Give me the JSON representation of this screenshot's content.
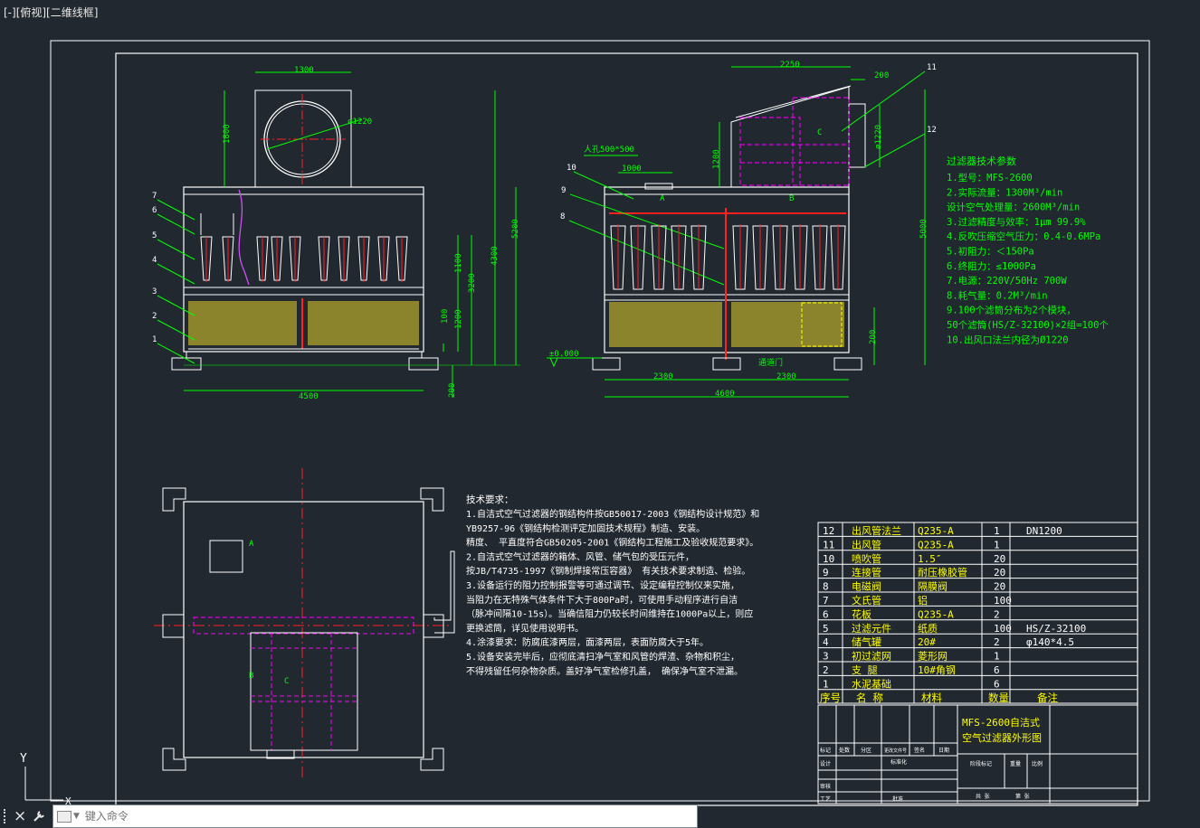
{
  "viewport": {
    "label": "[-][俯视][二维线框]"
  },
  "command_line": {
    "placeholder": "键入命令"
  },
  "ucs": {
    "y_label": "Y",
    "x_label": "X"
  },
  "front_view": {
    "dims": {
      "top_width": "1300",
      "diameter": "ø1220",
      "hood_height": "1800",
      "h5200": "5200",
      "h4300": "4300",
      "h3200": "3200",
      "h1100": "1100",
      "h1200": "1200",
      "h100": "100",
      "h200": "200",
      "width": "4500"
    },
    "balloons": [
      "7",
      "6",
      "5",
      "4",
      "3",
      "2",
      "1"
    ]
  },
  "side_view": {
    "dims": {
      "top_2250": "2250",
      "d200": "200",
      "d1000": "1000",
      "manhole": "人孔500*500",
      "h1200": "1200",
      "h5000": "5000",
      "dia": "ø1220",
      "h200": "200",
      "left2300": "2300",
      "right2300": "2300",
      "total": "4600",
      "elev": "±0.000"
    },
    "letters": {
      "a": "A",
      "b": "B",
      "c": "C"
    },
    "balloons": [
      "10",
      "9",
      "8",
      "11",
      "12"
    ],
    "access_door": "通道门"
  },
  "plan_view": {
    "letters": {
      "a": "A",
      "b": "B",
      "c": "C"
    }
  },
  "tech_params": {
    "title": "过滤器技术参数",
    "lines": [
      "1.型号：MFS-2600",
      "2.实际流量：1300M³/min",
      "  设计空气处理量：2600M³/min",
      "3.过滤精度与效率：1μm  99.9%",
      "4.反吹压缩空气压力：0.4-0.6MPa",
      "5.初阻力：＜150Pa",
      "6.终阻力：≤1000Pa",
      "7.电源：220V/50Hz 700W",
      "8.耗气量：0.2M³/min",
      "9.100个滤筒分布为2个模块，",
      "  50个滤筒(HS/Z-32100)×2组=100个",
      "10.出风口法兰内径为Ø1220"
    ]
  },
  "tech_requirements": {
    "title": "技术要求：",
    "lines": [
      "1.自洁式空气过滤器的钢结构件按GB50017-2003《钢结构设计规范》和",
      "YB9257-96《钢结构检测评定加固技术规程》制造、安装。",
      "精度、 平直度符合GB50205-2001《钢结构工程施工及验收规范要求》。",
      "2.自洁式空气过滤器的箱体、风管、储气包的受压元件，",
      "按JB/T4735-1997《钢制焊接常压容器》 有关技术要求制造、检验。",
      "3.设备运行的阻力控制报警等可通过调节、设定编程控制仪来实施，",
      "当阻力在无特殊气体条件下大于800Pa时，可使用手动程序进行自洁",
      "（脉冲间隔10-15s）。当确信阻力仍较长时间维持在1000Pa以上，则应",
      "更换滤筒，详见使用说明书。",
      "4.涂漆要求：防腐底漆两层，面漆两层，表面防腐大于5年。",
      "5.设备安装完毕后，应彻底清扫净气室和风管的焊渣、杂物和积尘，",
      "不得残留任何杂物杂质。盖好净气室检修孔盖， 确保净气室不泄漏。"
    ]
  },
  "bom": {
    "rows": [
      [
        "12",
        "出风管法兰",
        "Q235-A",
        "1",
        "DN1200"
      ],
      [
        "11",
        "出风管",
        "Q235-A",
        "1",
        ""
      ],
      [
        "10",
        "喷吹管",
        "1.5″",
        "20",
        ""
      ],
      [
        "9",
        "连接管",
        "耐压橡胶管",
        "20",
        ""
      ],
      [
        "8",
        "电磁阀",
        "隔膜阀",
        "20",
        ""
      ],
      [
        "7",
        "文氏管",
        "铝",
        "100",
        ""
      ],
      [
        "6",
        "花板",
        "Q235-A",
        "2",
        ""
      ],
      [
        "5",
        "过滤元件",
        "纸质",
        "100",
        "HS/Z-32100"
      ],
      [
        "4",
        "储气罐",
        "20#",
        "2",
        "φ140*4.5"
      ],
      [
        "3",
        "初过滤网",
        "菱形网",
        "1",
        ""
      ],
      [
        "2",
        "支  腿",
        "10#角钢",
        "6",
        ""
      ],
      [
        "1",
        "水泥基础",
        "",
        "6",
        ""
      ]
    ],
    "header": [
      "序号",
      "名 称",
      "材料",
      "数量",
      "备注"
    ]
  },
  "title_block": {
    "drawing_title_1": "MFS-2600自洁式",
    "drawing_title_2": "空气过滤器外形图",
    "labels": {
      "mark": "标记",
      "count": "处数",
      "zone": "分区",
      "doc": "更改文件号",
      "sign": "签名",
      "date": "日期",
      "design": "设计",
      "std": "标准化",
      "review": "审核",
      "process": "工艺",
      "approve": "批准",
      "stage": "阶段标记",
      "weight": "重量",
      "scale": "比例",
      "total": "共  张",
      "sheet": "第  张"
    }
  },
  "colors": {
    "bg": "#212830",
    "line": "#ffffff",
    "dim": "#00ff00",
    "center": "#ff2020",
    "hidden": "#ff00ff",
    "text_green": "#00ff00",
    "text_yellow": "#ffff00"
  }
}
